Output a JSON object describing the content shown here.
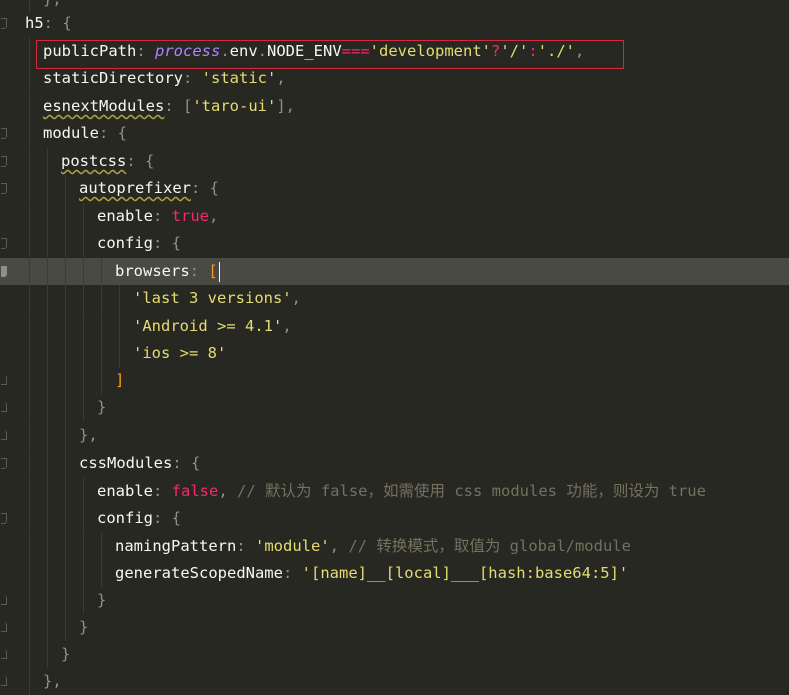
{
  "editor": {
    "lines": [
      {
        "tokens": [
          {
            "t": "},",
            "c": "t-punc"
          }
        ]
      },
      {
        "tokens": [
          {
            "t": "h5",
            "c": "t-text"
          },
          {
            "t": ": {",
            "c": "t-punc"
          }
        ]
      },
      {
        "tokens": [
          {
            "t": "publicPath",
            "c": "t-text"
          },
          {
            "t": ": ",
            "c": "t-punc"
          },
          {
            "t": "process",
            "c": "t-proc"
          },
          {
            "t": ".",
            "c": "t-punc"
          },
          {
            "t": "env",
            "c": "t-text"
          },
          {
            "t": ".",
            "c": "t-punc"
          },
          {
            "t": "NODE_ENV",
            "c": "t-text"
          },
          {
            "t": "===",
            "c": "t-op"
          },
          {
            "t": "'development'",
            "c": "t-str"
          },
          {
            "t": "?",
            "c": "t-op"
          },
          {
            "t": "'/'",
            "c": "t-str"
          },
          {
            "t": ":",
            "c": "t-op"
          },
          {
            "t": "'./'",
            "c": "t-str"
          },
          {
            "t": ",",
            "c": "t-punc"
          }
        ]
      },
      {
        "tokens": [
          {
            "t": "staticDirectory",
            "c": "t-text"
          },
          {
            "t": ": ",
            "c": "t-punc"
          },
          {
            "t": "'static'",
            "c": "t-str"
          },
          {
            "t": ",",
            "c": "t-punc"
          }
        ]
      },
      {
        "tokens": [
          {
            "t": "esnextModules",
            "c": "t-text squiggle"
          },
          {
            "t": ": [",
            "c": "t-punc"
          },
          {
            "t": "'taro-ui'",
            "c": "t-str"
          },
          {
            "t": "],",
            "c": "t-punc"
          }
        ]
      },
      {
        "tokens": [
          {
            "t": "module",
            "c": "t-text"
          },
          {
            "t": ": {",
            "c": "t-punc"
          }
        ]
      },
      {
        "tokens": [
          {
            "t": "postcss",
            "c": "t-text squiggle"
          },
          {
            "t": ": {",
            "c": "t-punc"
          }
        ]
      },
      {
        "tokens": [
          {
            "t": "autoprefixer",
            "c": "t-text squiggle"
          },
          {
            "t": ": {",
            "c": "t-punc"
          }
        ]
      },
      {
        "tokens": [
          {
            "t": "enable",
            "c": "t-text"
          },
          {
            "t": ": ",
            "c": "t-punc"
          },
          {
            "t": "true",
            "c": "t-bool"
          },
          {
            "t": ",",
            "c": "t-punc"
          }
        ]
      },
      {
        "tokens": [
          {
            "t": "config",
            "c": "t-text"
          },
          {
            "t": ": {",
            "c": "t-punc"
          }
        ]
      },
      {
        "tokens": [
          {
            "t": "browsers",
            "c": "t-text"
          },
          {
            "t": ": ",
            "c": "t-punc"
          },
          {
            "t": "[",
            "c": "t-bracket"
          }
        ]
      },
      {
        "tokens": [
          {
            "t": "'last 3 versions'",
            "c": "t-str"
          },
          {
            "t": ",",
            "c": "t-punc"
          }
        ]
      },
      {
        "tokens": [
          {
            "t": "'Android >= 4.1'",
            "c": "t-str"
          },
          {
            "t": ",",
            "c": "t-punc"
          }
        ]
      },
      {
        "tokens": [
          {
            "t": "'ios >= 8'",
            "c": "t-str"
          }
        ]
      },
      {
        "tokens": [
          {
            "t": "]",
            "c": "t-bracket"
          }
        ]
      },
      {
        "tokens": [
          {
            "t": "}",
            "c": "t-punc"
          }
        ]
      },
      {
        "tokens": [
          {
            "t": "},",
            "c": "t-punc"
          }
        ]
      },
      {
        "tokens": [
          {
            "t": "cssModules",
            "c": "t-text"
          },
          {
            "t": ": {",
            "c": "t-punc"
          }
        ]
      },
      {
        "tokens": [
          {
            "t": "enable",
            "c": "t-text"
          },
          {
            "t": ": ",
            "c": "t-punc"
          },
          {
            "t": "false",
            "c": "t-bool"
          },
          {
            "t": ", ",
            "c": "t-punc"
          },
          {
            "t": "// 默认为 false，如需使用 css modules 功能，则设为 true",
            "c": "t-comm"
          }
        ]
      },
      {
        "tokens": [
          {
            "t": "config",
            "c": "t-text"
          },
          {
            "t": ": {",
            "c": "t-punc"
          }
        ]
      },
      {
        "tokens": [
          {
            "t": "namingPattern",
            "c": "t-text"
          },
          {
            "t": ": ",
            "c": "t-punc"
          },
          {
            "t": "'module'",
            "c": "t-str"
          },
          {
            "t": ", ",
            "c": "t-punc"
          },
          {
            "t": "// 转换模式，取值为 global/module",
            "c": "t-comm"
          }
        ]
      },
      {
        "tokens": [
          {
            "t": "generateScopedName",
            "c": "t-text"
          },
          {
            "t": ": ",
            "c": "t-punc"
          },
          {
            "t": "'[name]__[local]___[hash:base64:5]'",
            "c": "t-str"
          }
        ]
      },
      {
        "tokens": [
          {
            "t": "}",
            "c": "t-punc"
          }
        ]
      },
      {
        "tokens": [
          {
            "t": "}",
            "c": "t-punc"
          }
        ]
      },
      {
        "tokens": [
          {
            "t": "}",
            "c": "t-punc"
          }
        ]
      },
      {
        "tokens": [
          {
            "t": "},",
            "c": "t-punc"
          }
        ]
      }
    ]
  }
}
